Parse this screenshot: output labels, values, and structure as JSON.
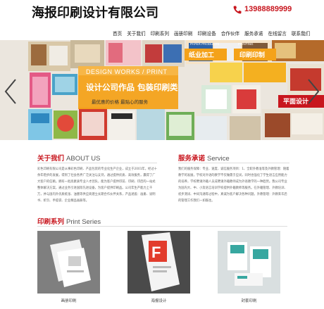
{
  "header": {
    "logo": "海报印刷设计有限公司",
    "phone": "13988889999"
  },
  "nav": [
    "首页",
    "关于我们",
    "印刷系列",
    "画册印刷",
    "印刷设备",
    "合作伙伴",
    "服务承诺",
    "在线留言",
    "联系我们"
  ],
  "banner": {
    "tag1": "DESIGN WORKS / PRINT",
    "headline": "设计公司作品 包装印刷类",
    "subline": "最优惠的价格 最贴心的服务",
    "label_paper": "纸业加工",
    "label_print": "印刷印制",
    "label_flat": "平面设计",
    "label_paper_en": "PAPER PRODUCTS",
    "label_print_en": "PRINTING"
  },
  "about": {
    "title_cn": "关于我们",
    "title_en": "ABOUT US",
    "text": "彩色印刷有限公司是从事彩色印刷、产品包装的专业化生产企业，成立于2001年，经过十余年稳步的发展，得到了社会各界广泛关注与支持，通过提供优质、高效服务，赢得了广大客户的信赖。拥有一批高素质专业人才团队，能为客户提供印前、印刷、印后的一站式整体解决方案，通过业务引进国际先进设备，为客户提供印刷品。公司年生产能力上千万，并与国内外优质纸张、油墨等供应商建立长期合作伙伴关系，产品涵盖：画册、说明书、折页、手提袋、企业精品画册等。"
  },
  "service": {
    "title_cn": "服务承诺",
    "title_en": "Service",
    "text": "我们的服务保障：专业、速度、诚信服务项目：1、全职外教准等及外教管理：随着教学的发展，学校对外语的教学不仅做需于应试，同时也强化了学生语言应用能力的培养，学校聘请外籍人员成聘请外籍教师成为外语教学的一种趋势。我公司专业为国内大、中、小及语言培训学校提供外籍教师等服务。在外籍管理、外教培训、初步测试、中间沟通等过程中，真诚为客户解决各种问题。外教管理：外教来华后的管理工作我们一如既往。"
  },
  "print": {
    "title_cn": "印刷系列",
    "title_en": "Print Series",
    "items": [
      {
        "caption": "画册印刷"
      },
      {
        "caption": "海报设计"
      },
      {
        "caption": "封套印刷"
      }
    ]
  },
  "colors": {
    "accent": "#c8161e",
    "banner_orange": "#f4a21a"
  },
  "icons": {
    "phone": "phone-icon",
    "prev": "chevron-left-icon",
    "next": "chevron-right-icon"
  }
}
